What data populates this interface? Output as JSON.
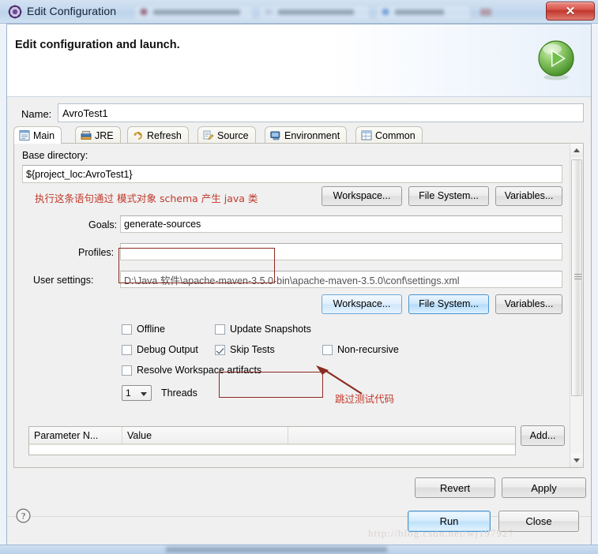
{
  "titlebar": {
    "title": "Edit Configuration",
    "icon": "eclipse-launch-icon",
    "close_label": "✕"
  },
  "header": {
    "title": "Edit configuration and launch.",
    "run_icon": "green-run-circle-icon"
  },
  "name_field": {
    "label": "Name:",
    "value": "AvroTest1"
  },
  "tabs": [
    {
      "label": "Main",
      "icon": "main-document-icon",
      "active": true
    },
    {
      "label": "JRE",
      "icon": "jre-library-icon",
      "active": false
    },
    {
      "label": "Refresh",
      "icon": "refresh-arrows-icon",
      "active": false
    },
    {
      "label": "Source",
      "icon": "source-pencil-icon",
      "active": false
    },
    {
      "label": "Environment",
      "icon": "environment-icon",
      "active": false
    },
    {
      "label": "Common",
      "icon": "common-table-icon",
      "active": false
    }
  ],
  "main_tab": {
    "base_directory": {
      "label": "Base directory:",
      "value": "${project_loc:AvroTest1}"
    },
    "dir_buttons": [
      {
        "label": "Workspace...",
        "style": "normal"
      },
      {
        "label": "File System...",
        "style": "normal"
      },
      {
        "label": "Variables...",
        "style": "normal"
      }
    ],
    "goals": {
      "label": "Goals:",
      "value": "generate-sources"
    },
    "profiles": {
      "label": "Profiles:",
      "value": ""
    },
    "user_settings": {
      "label": "User settings:",
      "value": "D:\\Java 软件\\apache-maven-3.5.0-bin\\apache-maven-3.5.0\\conf\\settings.xml"
    },
    "settings_buttons": [
      {
        "label": "Workspace...",
        "style": "blue"
      },
      {
        "label": "File System...",
        "style": "blue-strong"
      },
      {
        "label": "Variables...",
        "style": "normal"
      }
    ],
    "checkboxes": [
      {
        "label": "Offline",
        "checked": false
      },
      {
        "label": "Update Snapshots",
        "checked": false
      },
      {
        "label": "Debug Output",
        "checked": false
      },
      {
        "label": "Skip Tests",
        "checked": true
      },
      {
        "label": "Non-recursive",
        "checked": false
      },
      {
        "label": "Resolve Workspace artifacts",
        "checked": false
      }
    ],
    "threads": {
      "value": "1",
      "label": "Threads"
    },
    "parameters_table": {
      "columns": [
        "Parameter N...",
        "Value",
        ""
      ],
      "rows": []
    },
    "add_button": "Add..."
  },
  "footer": {
    "revert_label": "Revert",
    "apply_label": "Apply",
    "help_icon": "help-question-icon",
    "run_label": "Run",
    "close_label": "Close"
  },
  "annotations": {
    "goals_note": "执行这条语句通过 模式对象 schema 产生 java 类",
    "skip_tests_note": "跳过测试代码"
  },
  "watermark": "http://blog.csdn.net/wj197927",
  "colors": {
    "annotation_red": "#c0392b",
    "annotation_box": "#8b2a20",
    "titlebar_blue": "#c4d8ee",
    "accent_blue": "#4a95cf",
    "run_green": "#4fa32c"
  }
}
